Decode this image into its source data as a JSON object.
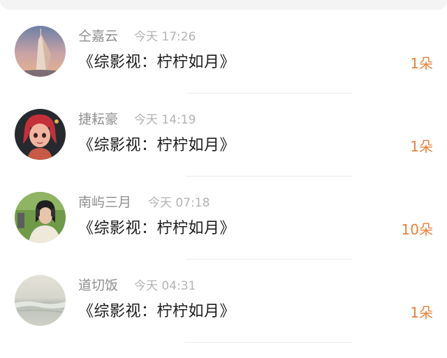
{
  "records": [
    {
      "name": "仝嘉云",
      "time": "今天 17:26",
      "title": "《综影视：柠柠如月》",
      "count": "1朵",
      "avatar": "tower-avatar"
    },
    {
      "name": "捷耘豪",
      "time": "今天 14:19",
      "title": "《综影视：柠柠如月》",
      "count": "1朵",
      "avatar": "cartoon-girl-avatar"
    },
    {
      "name": "南屿三月",
      "time": "今天 07:18",
      "title": "《综影视：柠柠如月》",
      "count": "10朵",
      "avatar": "headphone-girl-avatar"
    },
    {
      "name": "道切饭",
      "time": "今天 04:31",
      "title": "《综影视：柠柠如月》",
      "count": "1朵",
      "avatar": "beach-avatar"
    }
  ],
  "colors": {
    "accent": "#e8823a",
    "name_text": "#8f8f8f",
    "time_text": "#b3b3b3",
    "title_text": "#1c1c1c"
  }
}
